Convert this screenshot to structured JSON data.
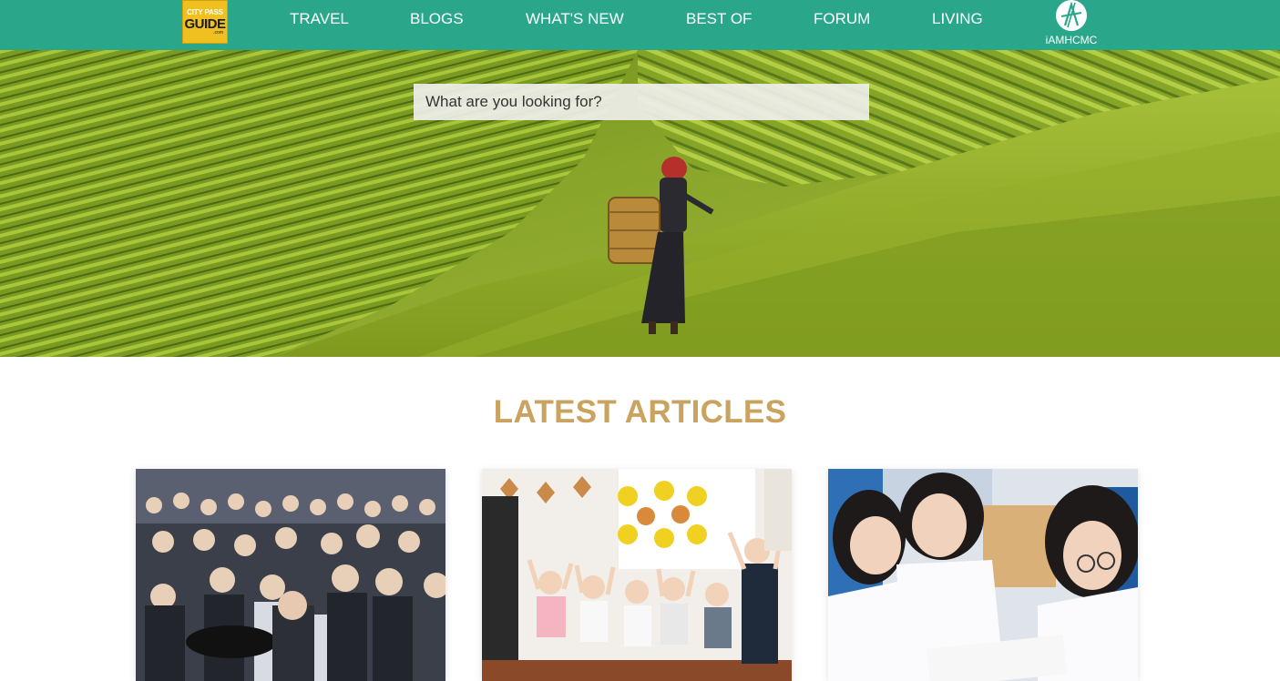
{
  "header": {
    "logo": {
      "line1": "CITY PASS",
      "line2": "GUIDE",
      "line3": ".com"
    },
    "nav": [
      {
        "label": "TRAVEL"
      },
      {
        "label": "BLOGS"
      },
      {
        "label": "WHAT'S NEW"
      },
      {
        "label": "BEST OF"
      },
      {
        "label": "FORUM"
      },
      {
        "label": "LIVING"
      }
    ],
    "partner": {
      "label": "iAMHCMC",
      "icon": "iamhcmc-logo-icon"
    }
  },
  "hero": {
    "search": {
      "placeholder": "What are you looking for?",
      "value": ""
    }
  },
  "articles": {
    "title": "LATEST ARTICLES"
  },
  "colors": {
    "nav_bg": "#2aa78a",
    "title": "#c9a35f",
    "logo_bg": "#f0c020"
  }
}
